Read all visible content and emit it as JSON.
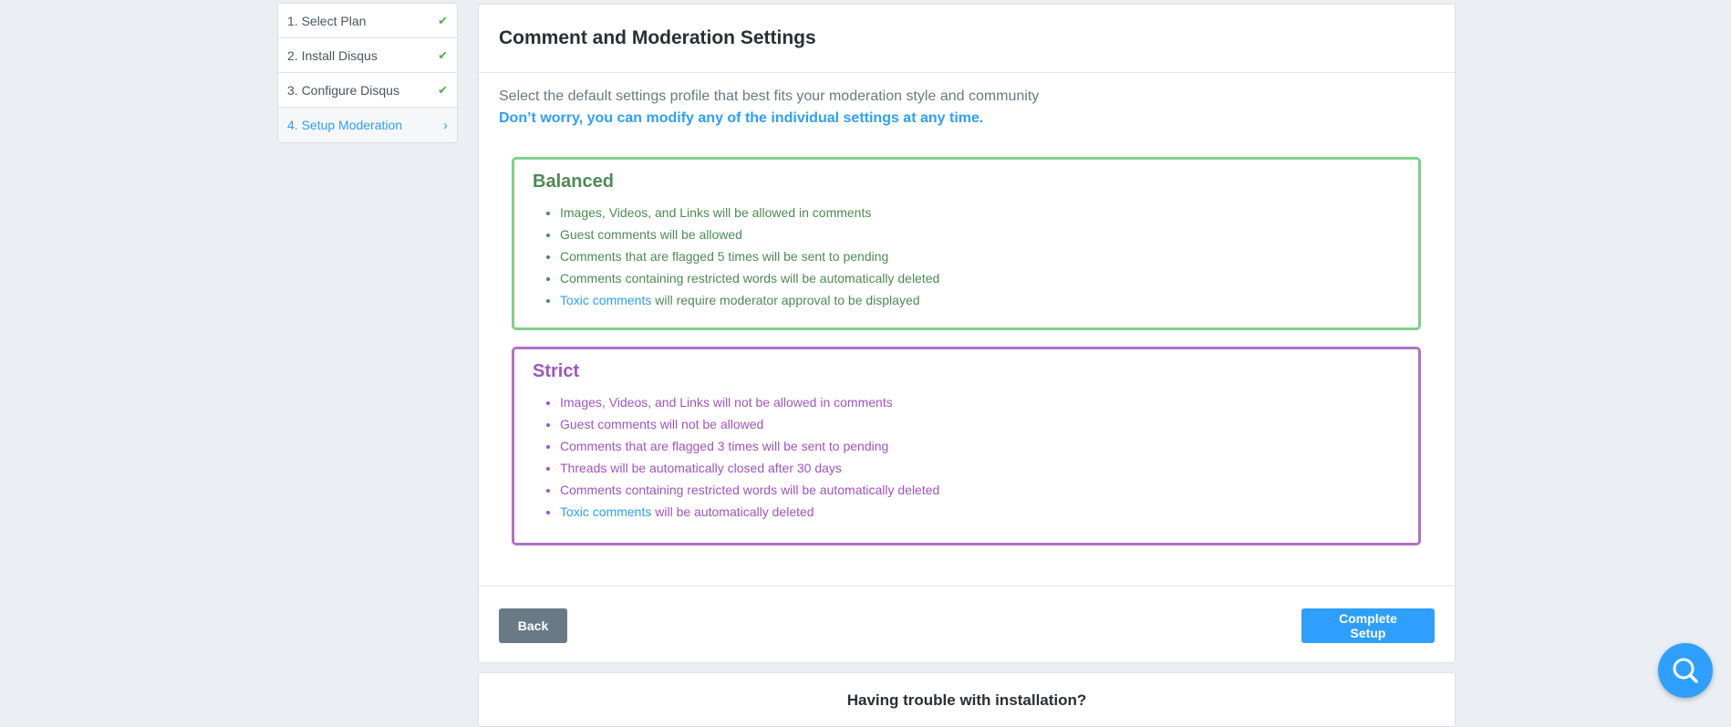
{
  "sidebar": {
    "steps": [
      {
        "label": "1. Select Plan",
        "state": "done"
      },
      {
        "label": "2. Install Disqus",
        "state": "done"
      },
      {
        "label": "3. Configure Disqus",
        "state": "done"
      },
      {
        "label": "4. Setup Moderation",
        "state": "active"
      }
    ],
    "check_glyph": "✔",
    "chevron_glyph": "›"
  },
  "card": {
    "title": "Comment and Moderation Settings",
    "intro_line1": "Select the default settings profile that best fits your moderation style and community",
    "intro_line2": "Don’t worry, you can modify any of the individual settings at any time."
  },
  "profiles": {
    "balanced": {
      "title": "Balanced",
      "color": "#4e8a55",
      "border_color": "#7fcf89",
      "items": [
        "Images, Videos, and Links will be allowed in comments",
        "Guest comments will be allowed",
        "Comments that are flagged 5 times will be sent to pending",
        "Comments containing restricted words will be automatically deleted"
      ],
      "toxic_link": "Toxic comments",
      "toxic_rest": "will require moderator approval to be displayed"
    },
    "strict": {
      "title": "Strict",
      "color": "#a055c0",
      "border_color": "#b071c6",
      "items": [
        "Images, Videos, and Links will not be allowed in comments",
        "Guest comments will not be allowed",
        "Comments that are flagged 3 times will be sent to pending",
        "Threads will be automatically closed after 30 days",
        "Comments containing restricted words will be automatically deleted"
      ],
      "toxic_link": "Toxic comments",
      "toxic_rest": "will be automatically deleted"
    }
  },
  "footer": {
    "back_label": "Back",
    "complete_label": "Complete Setup"
  },
  "help": {
    "title": "Having trouble with installation?",
    "fab_icon": "search-icon"
  },
  "colors": {
    "accent": "#2e9fff",
    "success": "#4caf50",
    "back_button": "#687a86",
    "background": "#ebeef2"
  }
}
